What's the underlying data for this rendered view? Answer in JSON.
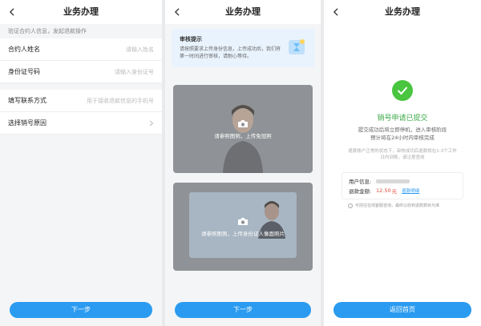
{
  "screen1": {
    "title": "业务办理",
    "notice": "验证合约人信息，发起退款操作",
    "fields": [
      {
        "label": "合约人姓名",
        "placeholder": "请输入姓名"
      },
      {
        "label": "身份证号码",
        "placeholder": "请输入身份证号"
      }
    ],
    "contact": {
      "label": "填写联系方式",
      "placeholder": "用于接收退款信息的手机号"
    },
    "reason": {
      "label": "选择销号原因"
    },
    "next_label": "下一步"
  },
  "screen2": {
    "title": "业务办理",
    "tip_title": "审核提示",
    "tip_text": "请按照要求上传身份信息，上传成功后，我们将第一时间进行审核，请耐心等待。",
    "upload_face": "请参照图例，上传免冠照",
    "upload_card": "请参照图例，上传身份证人像面照片",
    "next_label": "下一步"
  },
  "screen3": {
    "title": "业务办理",
    "status": "销号申请已提交",
    "sub_line1": "提交成功后将立即停机，进入审核阶段",
    "sub_line2": "预计将在24小时内审核完成",
    "note": "退款账户正常的状态下，审核成功后退款将在1-3个工作日内到账，请注意查收",
    "user_label": "用户信息:",
    "amount_label": "退款金额:",
    "amount_value": "12.50",
    "amount_unit": "元",
    "detail_link": "退款明细",
    "hint": "可前往在线客服咨询，最终以收到退款数目为准",
    "home_label": "返回首页"
  },
  "colors": {
    "accent": "#2a9bf0",
    "success": "#49c53f",
    "amount": "#e04a3a"
  }
}
